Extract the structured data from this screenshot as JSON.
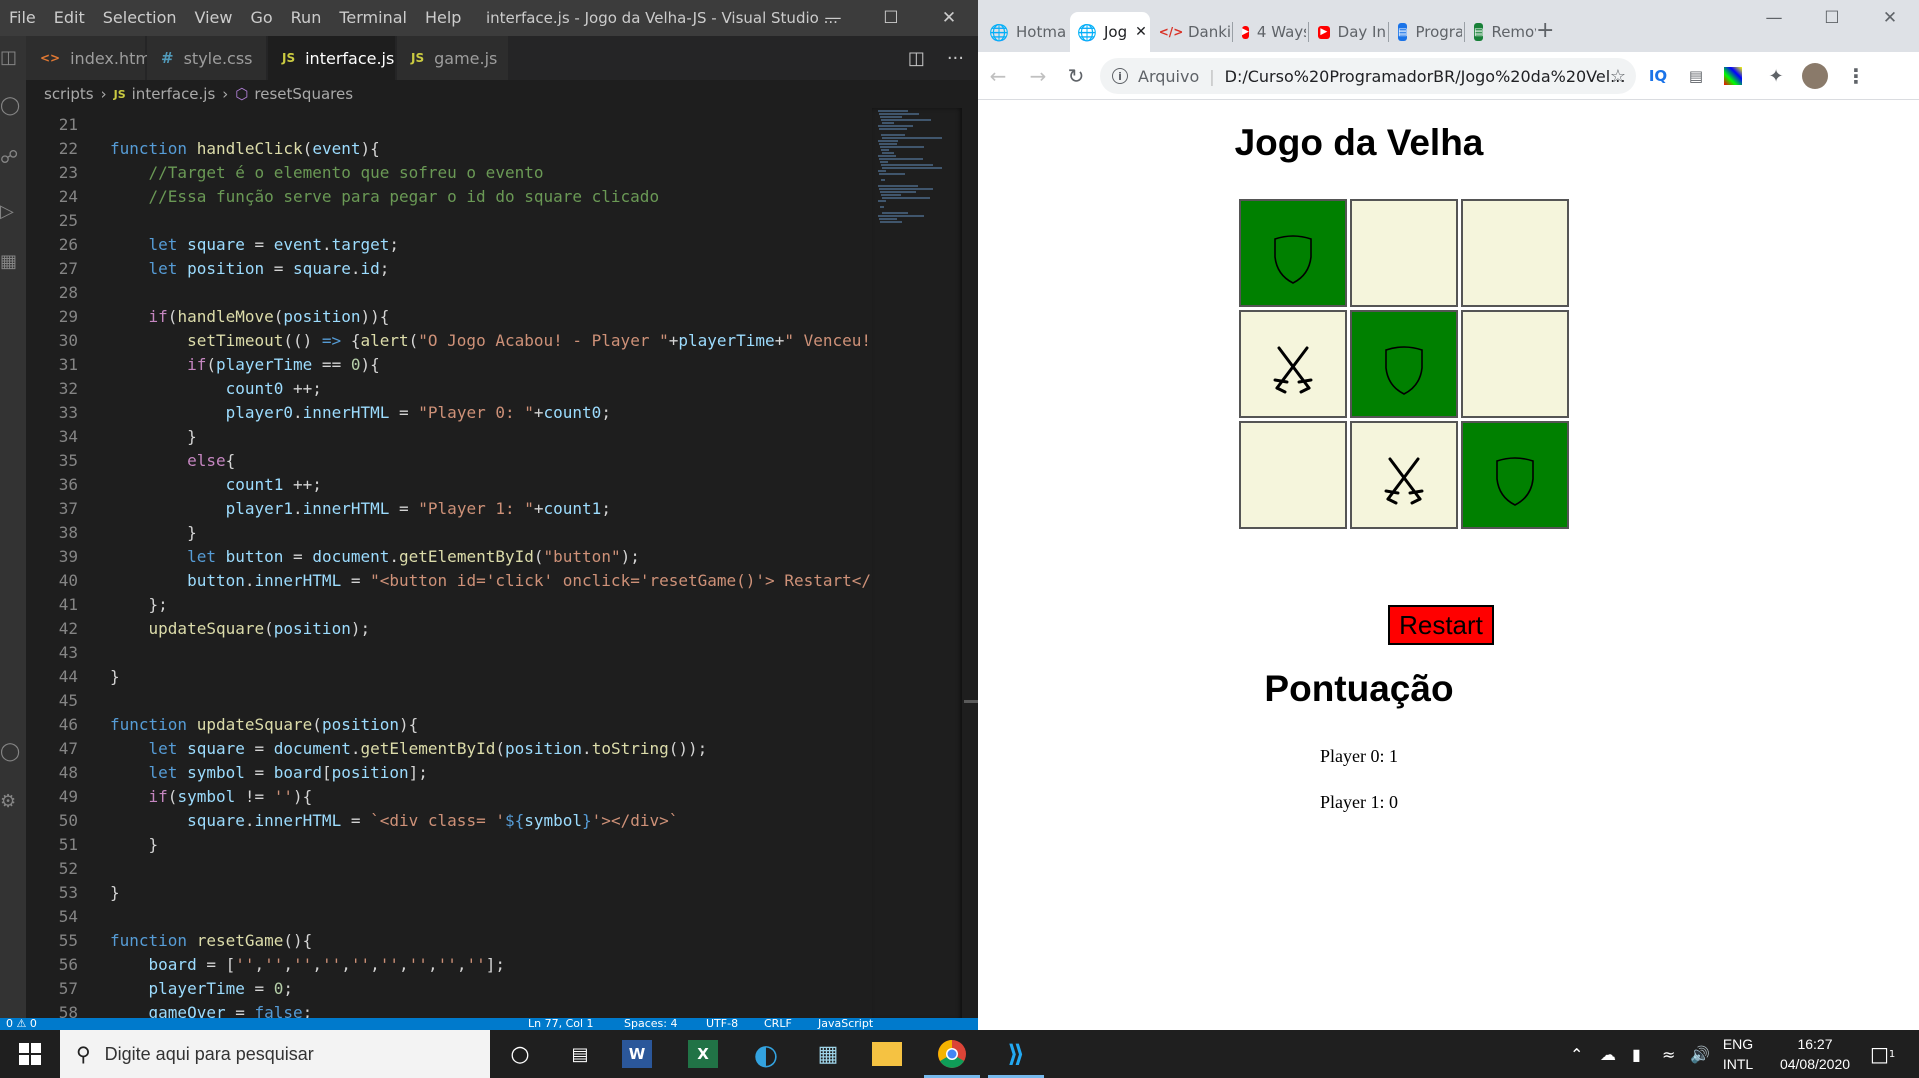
{
  "vscode": {
    "menu": [
      "File",
      "Edit",
      "Selection",
      "View",
      "Go",
      "Run",
      "Terminal",
      "Help"
    ],
    "window_title": "interface.js - Jogo da Velha-JS - Visual Studio ...",
    "tabs": [
      {
        "label": "index.html",
        "icon": "<>",
        "icon_color": "#e37933"
      },
      {
        "label": "style.css",
        "icon": "#",
        "icon_color": "#519aba"
      },
      {
        "label": "interface.js",
        "icon": "JS",
        "icon_color": "#cbcb41",
        "active": true
      },
      {
        "label": "game.js",
        "icon": "JS",
        "icon_color": "#cbcb41"
      }
    ],
    "breadcrumb": {
      "folder": "scripts",
      "file": "interface.js",
      "symbol": "resetSquares"
    },
    "status": {
      "left": "0 ⚠ 0",
      "position": "Ln 77, Col 1",
      "spaces": "Spaces: 4",
      "encoding": "UTF-8",
      "eol": "CRLF",
      "language": "JavaScript"
    }
  },
  "code_lines": [
    {
      "n": "21",
      "html": ""
    },
    {
      "n": "22",
      "html": "<span class='k'>function</span> <span class='f'>handleClick</span>(<span class='v'>event</span>){"
    },
    {
      "n": "23",
      "html": "    <span class='c'>//Target é o elemento que sofreu o evento</span>"
    },
    {
      "n": "24",
      "html": "    <span class='c'>//Essa função serve para pegar o id do square clicado</span>"
    },
    {
      "n": "25",
      "html": ""
    },
    {
      "n": "26",
      "html": "    <span class='k'>let</span> <span class='v'>square</span> = <span class='v'>event</span>.<span class='v'>target</span>;"
    },
    {
      "n": "27",
      "html": "    <span class='k'>let</span> <span class='v'>position</span> = <span class='v'>square</span>.<span class='v'>id</span>;"
    },
    {
      "n": "28",
      "html": ""
    },
    {
      "n": "29",
      "html": "    <span class='kc'>if</span>(<span class='f'>handleMove</span>(<span class='v'>position</span>)){"
    },
    {
      "n": "30",
      "html": "        <span class='f'>setTimeout</span>(() <span class='k'>=&gt;</span> {<span class='f'>alert</span>(<span class='s'>\"O Jogo Acabou! - Player \"</span>+<span class='v'>playerTime</span>+<span class='s'>\" Venceu!\"</span>"
    },
    {
      "n": "31",
      "html": "        <span class='kc'>if</span>(<span class='v'>playerTime</span> == <span class='n'>0</span>){"
    },
    {
      "n": "32",
      "html": "            <span class='v'>count0</span> ++;"
    },
    {
      "n": "33",
      "html": "            <span class='v'>player0</span>.<span class='v'>innerHTML</span> = <span class='s'>\"Player 0: \"</span>+<span class='v'>count0</span>;"
    },
    {
      "n": "34",
      "html": "        }"
    },
    {
      "n": "35",
      "html": "        <span class='kc'>else</span>{"
    },
    {
      "n": "36",
      "html": "            <span class='v'>count1</span> ++;"
    },
    {
      "n": "37",
      "html": "            <span class='v'>player1</span>.<span class='v'>innerHTML</span> = <span class='s'>\"Player 1: \"</span>+<span class='v'>count1</span>;"
    },
    {
      "n": "38",
      "html": "        }"
    },
    {
      "n": "39",
      "html": "        <span class='k'>let</span> <span class='v'>button</span> = <span class='v'>document</span>.<span class='f'>getElementById</span>(<span class='s'>\"button\"</span>);"
    },
    {
      "n": "40",
      "html": "        <span class='v'>button</span>.<span class='v'>innerHTML</span> = <span class='s'>\"&lt;button id='click' onclick='resetGame()'&gt; Restart&lt;/b</span>"
    },
    {
      "n": "41",
      "html": "    };"
    },
    {
      "n": "42",
      "html": "    <span class='f'>updateSquare</span>(<span class='v'>position</span>);"
    },
    {
      "n": "43",
      "html": ""
    },
    {
      "n": "44",
      "html": "}"
    },
    {
      "n": "45",
      "html": ""
    },
    {
      "n": "46",
      "html": "<span class='k'>function</span> <span class='f'>updateSquare</span>(<span class='v'>position</span>){"
    },
    {
      "n": "47",
      "html": "    <span class='k'>let</span> <span class='v'>square</span> = <span class='v'>document</span>.<span class='f'>getElementById</span>(<span class='v'>position</span>.<span class='f'>toString</span>());"
    },
    {
      "n": "48",
      "html": "    <span class='k'>let</span> <span class='v'>symbol</span> = <span class='v'>board</span>[<span class='v'>position</span>];"
    },
    {
      "n": "49",
      "html": "    <span class='kc'>if</span>(<span class='v'>symbol</span> != <span class='s'>''</span>){"
    },
    {
      "n": "50",
      "html": "        <span class='v'>square</span>.<span class='v'>innerHTML</span> = <span class='s'>`&lt;div class= '</span><span class='k'>${</span><span class='v'>symbol</span><span class='k'>}</span><span class='s'>'&gt;&lt;/div&gt;`</span>"
    },
    {
      "n": "51",
      "html": "    }"
    },
    {
      "n": "52",
      "html": ""
    },
    {
      "n": "53",
      "html": "}"
    },
    {
      "n": "54",
      "html": ""
    },
    {
      "n": "55",
      "html": "<span class='k'>function</span> <span class='f'>resetGame</span>(){"
    },
    {
      "n": "56",
      "html": "    <span class='v'>board</span> = [<span class='s'>''</span>,<span class='s'>''</span>,<span class='s'>''</span>,<span class='s'>''</span>,<span class='s'>''</span>,<span class='s'>''</span>,<span class='s'>''</span>,<span class='s'>''</span>,<span class='s'>''</span>];"
    },
    {
      "n": "57",
      "html": "    <span class='v'>playerTime</span> = <span class='n'>0</span>;"
    },
    {
      "n": "58",
      "html": "    <span class='v'>gameOver</span> = <span class='k'>false</span>;"
    }
  ],
  "chrome": {
    "tabs": [
      {
        "label": "Hotma",
        "icon": "globe",
        "icon_color": "#5f6368"
      },
      {
        "label": "Jog",
        "icon": "globe",
        "icon_color": "#5f6368",
        "active": true
      },
      {
        "label": "Danki",
        "icon": "code",
        "icon_color": "#d93025"
      },
      {
        "label": "4 Ways",
        "icon": "youtube",
        "icon_color": "#ff0000"
      },
      {
        "label": "Day In",
        "icon": "youtube",
        "icon_color": "#ff0000"
      },
      {
        "label": "Progra",
        "icon": "doc",
        "icon_color": "#1a73e8"
      },
      {
        "label": "Remov",
        "icon": "doc",
        "icon_color": "#188038"
      }
    ],
    "address_label": "Arquivo",
    "url": "D:/Curso%20ProgramadorBR/Jogo%20da%20Vel..."
  },
  "game": {
    "title": "Jogo da Velha",
    "squares": [
      {
        "symbol": "shield",
        "winning": true
      },
      {
        "symbol": "",
        "winning": false
      },
      {
        "symbol": "",
        "winning": false
      },
      {
        "symbol": "swords",
        "winning": false
      },
      {
        "symbol": "shield",
        "winning": true
      },
      {
        "symbol": "",
        "winning": false
      },
      {
        "symbol": "",
        "winning": false
      },
      {
        "symbol": "swords",
        "winning": false
      },
      {
        "symbol": "shield",
        "winning": true
      }
    ],
    "restart_label": "Restart",
    "score_title": "Pontuação",
    "player0": "Player 0: 1",
    "player1": "Player 1: 0"
  },
  "taskbar": {
    "search_placeholder": "Digite aqui para pesquisar",
    "lang": "ENG",
    "layout": "INTL",
    "time": "16:27",
    "date": "04/08/2020",
    "notification_count": "1"
  }
}
